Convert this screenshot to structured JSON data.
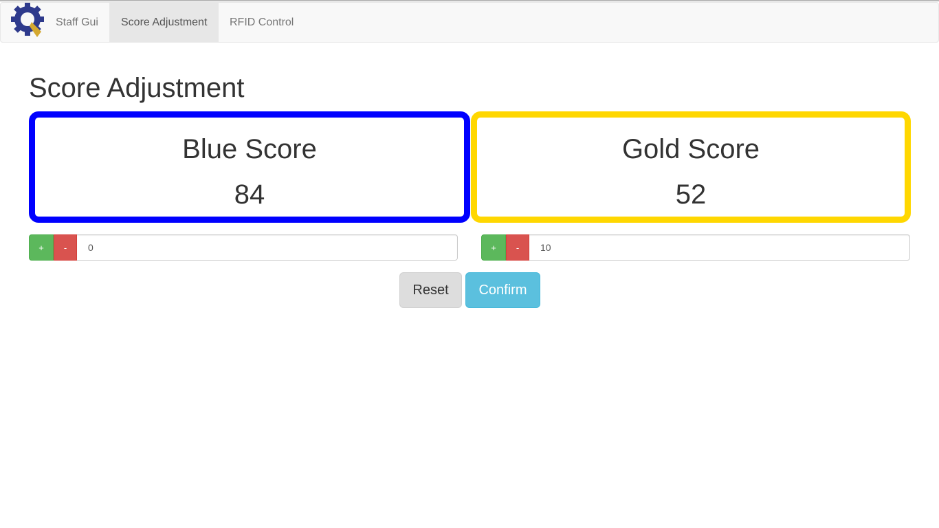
{
  "navbar": {
    "brand_icon": "gear-logo-icon",
    "brand_text": "Staff Gui",
    "tabs": [
      {
        "label": "Score Adjustment",
        "active": true
      },
      {
        "label": "RFID Control",
        "active": false
      }
    ]
  },
  "page": {
    "title": "Score Adjustment"
  },
  "scores": {
    "blue": {
      "label": "Blue Score",
      "value": "84",
      "color": "#0000ff"
    },
    "gold": {
      "label": "Gold Score",
      "value": "52",
      "color": "#ffd700"
    }
  },
  "adjust": {
    "blue": {
      "plus_label": "+",
      "minus_label": "-",
      "value": "0"
    },
    "gold": {
      "plus_label": "+",
      "minus_label": "-",
      "value": "10"
    }
  },
  "actions": {
    "reset_label": "Reset",
    "confirm_label": "Confirm"
  },
  "colors": {
    "plus": "#5cb85c",
    "minus": "#d9534f",
    "confirm": "#5bc0de",
    "reset": "#dddddd"
  }
}
